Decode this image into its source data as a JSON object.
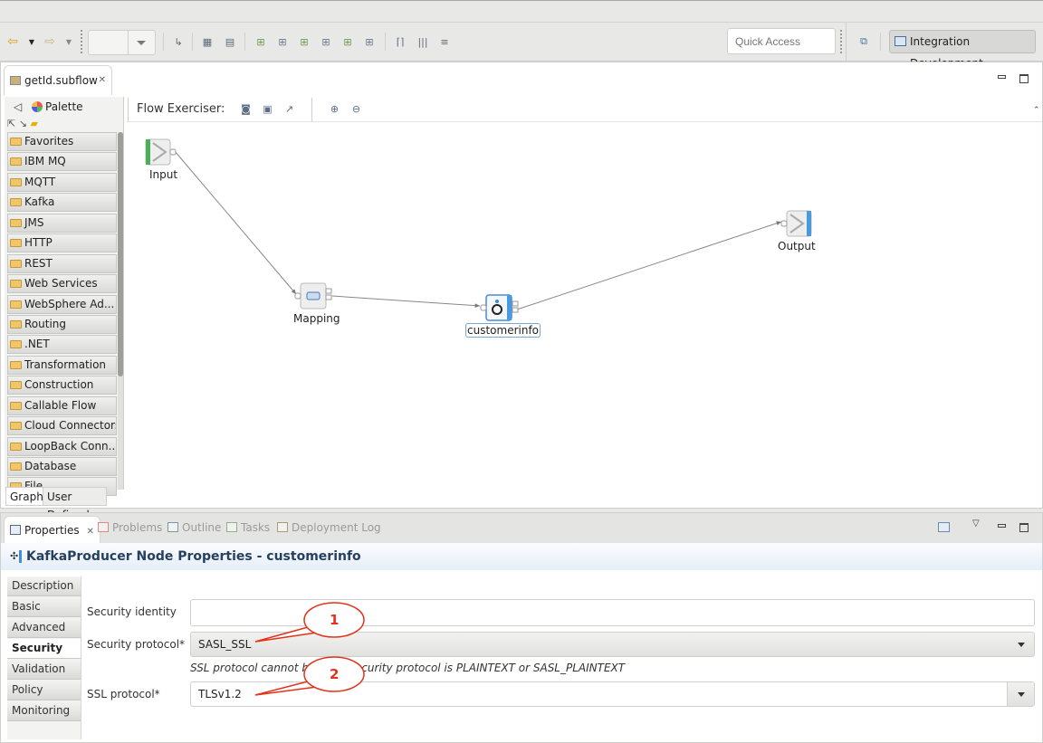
{
  "toolbar": {
    "quick_access_placeholder": "Quick Access",
    "perspective_label": "Integration Development",
    "icons": [
      "back-arrow-icon",
      "dropdown-icon",
      "forward-arrow-icon",
      "dropdown-icon",
      "connection-icon",
      "grid-icon",
      "table-icon",
      "align-left-icon",
      "align-center-icon",
      "align-right-icon",
      "align-top-icon",
      "align-middle-icon",
      "align-bottom-icon",
      "match-width-icon",
      "distribute-icon",
      "layout-icon",
      "open-perspective-icon"
    ]
  },
  "editor": {
    "tab_title": "getId.subflow",
    "palette": {
      "title": "Palette",
      "items": [
        "Favorites",
        "IBM MQ",
        "MQTT",
        "Kafka",
        "JMS",
        "HTTP",
        "REST",
        "Web Services",
        "WebSphere Ad...",
        "Routing",
        ".NET",
        "Transformation",
        "Construction",
        "Callable Flow",
        "Cloud Connectors",
        "LoopBack Conn...",
        "Database",
        "File"
      ]
    },
    "flow_exerciser_label": "Flow Exerciser:",
    "nodes": [
      {
        "id": "input",
        "label": "Input"
      },
      {
        "id": "mapping",
        "label": "Mapping"
      },
      {
        "id": "customerinfo",
        "label": "customerinfo"
      },
      {
        "id": "output",
        "label": "Output"
      }
    ],
    "connections": [
      [
        "input",
        "mapping"
      ],
      [
        "mapping",
        "customerinfo"
      ],
      [
        "customerinfo",
        "output"
      ]
    ],
    "bottom_tabs": [
      "Graph",
      "User Defined Properties"
    ]
  },
  "properties": {
    "tabs": [
      "Properties",
      "Problems",
      "Outline",
      "Tasks",
      "Deployment Log"
    ],
    "title": "KafkaProducer Node Properties - customerinfo",
    "sections": [
      "Description",
      "Basic",
      "Advanced",
      "Security",
      "Validation",
      "Policy",
      "Monitoring"
    ],
    "active_section": "Security",
    "fields": {
      "security_identity_label": "Security identity",
      "security_identity_value": "",
      "security_protocol_label": "Security protocol*",
      "security_protocol_value": "SASL_SSL",
      "hint": "SSL protocol cannot be set if security protocol is PLAINTEXT or SASL_PLAINTEXT",
      "ssl_protocol_label": "SSL protocol*",
      "ssl_protocol_value": "TLSv1.2"
    },
    "callouts": [
      "1",
      "2"
    ],
    "callout_color": "#e2321a"
  }
}
